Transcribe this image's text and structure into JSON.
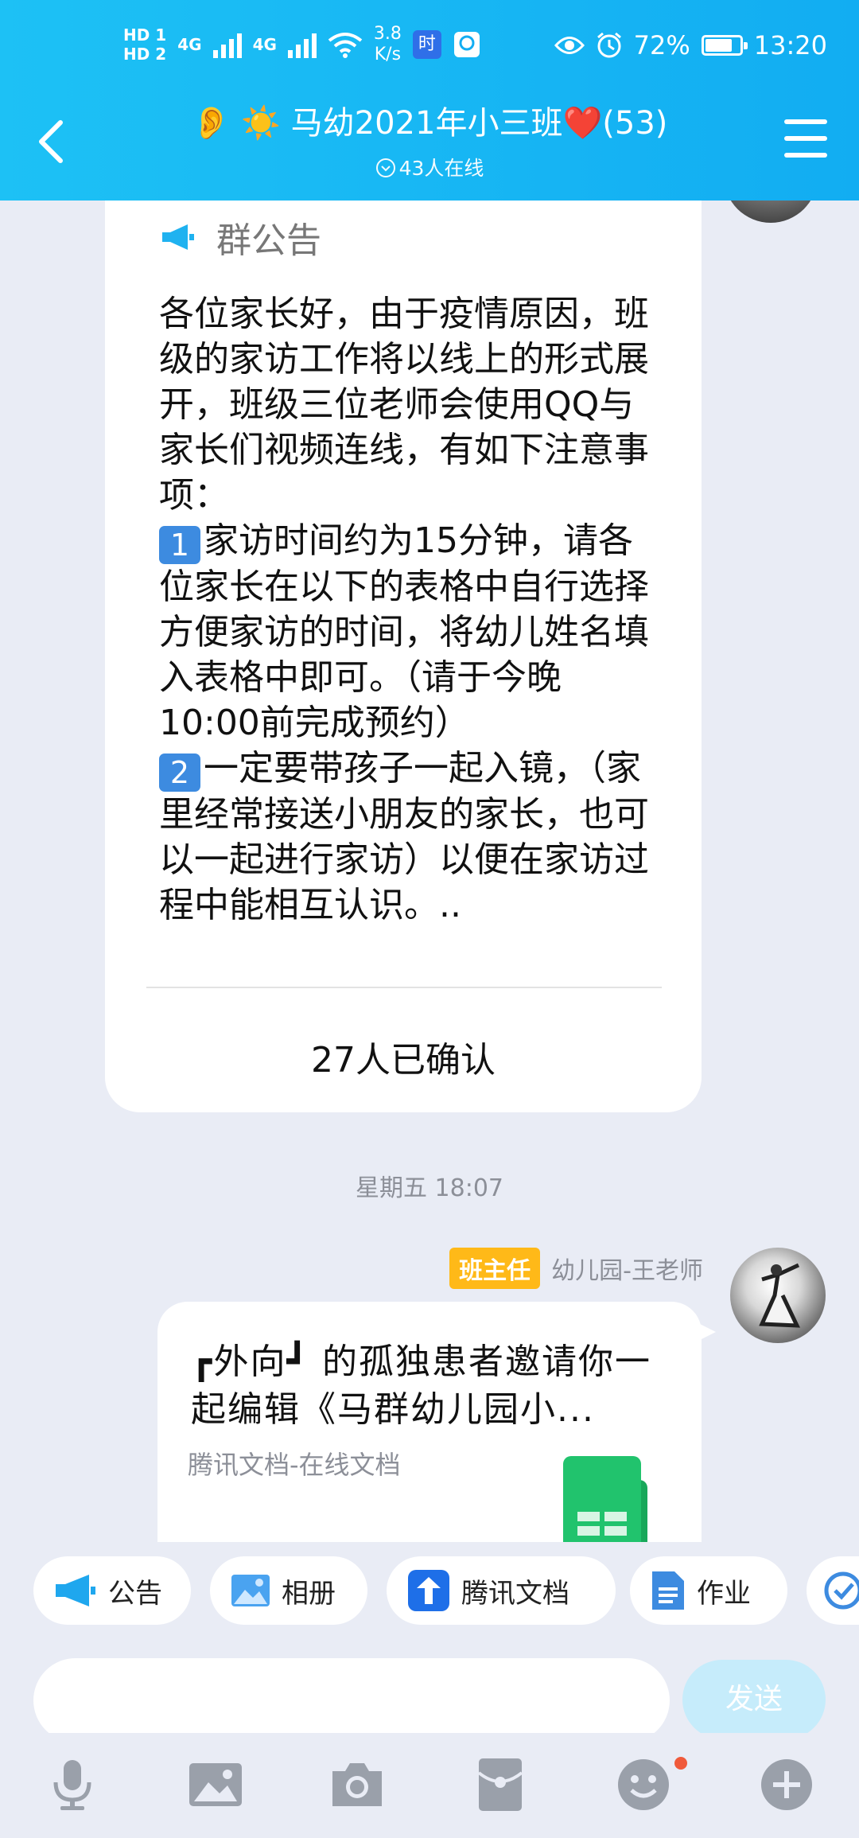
{
  "status_bar": {
    "hd1": "HD 1",
    "hd2": "HD 2",
    "net1": "4G",
    "net2": "4G",
    "speed_value": "3.8",
    "speed_unit": "K/s",
    "app_icon_1": "时",
    "battery_percent": "72%",
    "battery_level": 0.72,
    "time": "13:20"
  },
  "nav": {
    "title": "👂 ☀️ 马幼2021年小三班❤️(53)",
    "online": "43人在线"
  },
  "notice": {
    "label": "群公告",
    "paragraphs": [
      "各位家长好，由于疫情原因，班级的家访工作将以线上的形式展开，班级三位老师会使用QQ与家长们视频连线，有如下注意事项：",
      "家访时间约为15分钟，请各位家长在以下的表格中自行选择方便家访的时间，将幼儿姓名填入表格中即可。（请于今晚10:00前完成预约）",
      "一定要带孩子一起入镜，（家里经常接送小朋友的家长，也可以一起进行家访）以便在家访过程中能相互认识。.."
    ],
    "keycap1": "1",
    "keycap2": "2",
    "confirmed": "27人已确认"
  },
  "chat": {
    "timestamp": "星期五 18:07",
    "sender_badge": "班主任",
    "sender_name": "幼儿园-王老师",
    "message_text": "┏外向┛ 的孤独患者邀请你一起编辑《马群幼儿园小...",
    "message_source": "腾讯文档-在线文档"
  },
  "shortcuts": [
    {
      "label": "公告",
      "icon": "megaphone-icon"
    },
    {
      "label": "相册",
      "icon": "photo-album-icon"
    },
    {
      "label": "腾讯文档",
      "icon": "tencent-docs-icon"
    },
    {
      "label": "作业",
      "icon": "homework-icon"
    }
  ],
  "input": {
    "value": "",
    "send_label": "发送"
  },
  "toolbar": [
    "microphone-icon",
    "image-icon",
    "camera-icon",
    "red-packet-icon",
    "emoji-icon",
    "plus-icon"
  ],
  "colors": {
    "header": "#12adf2",
    "badge": "#ffb918",
    "send_disabled": "#c6ecfb",
    "notify_dot": "#f05a3b"
  }
}
